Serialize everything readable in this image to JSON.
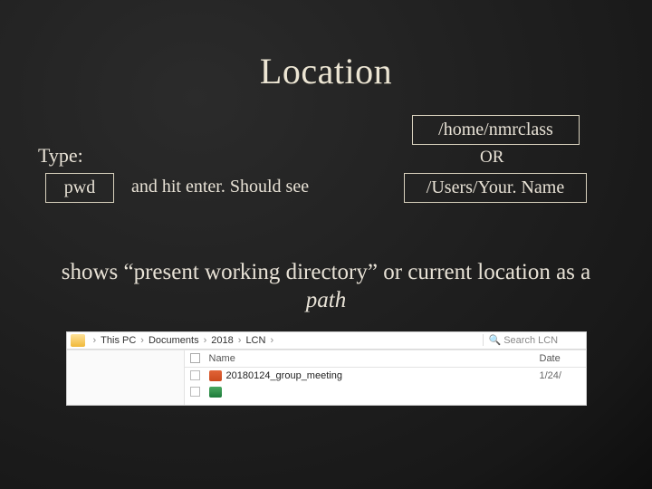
{
  "title": "Location",
  "type_label": "Type:",
  "pwd_box": "pwd",
  "instruction": "and hit enter. Should see",
  "path_home": "/home/nmrclass",
  "or_label": "OR",
  "path_users": "/Users/Your. Name",
  "desc_prefix": "shows “present working directory” or current location as a ",
  "desc_italic": "path",
  "explorer": {
    "crumbs": [
      "This PC",
      "Documents",
      "2018",
      "LCN"
    ],
    "search_placeholder": "Search LCN",
    "col_name": "Name",
    "col_date": "Date",
    "rows": [
      {
        "icon": "ppt",
        "name": "20180124_group_meeting",
        "date": "1/24/"
      },
      {
        "icon": "xls",
        "name": "",
        "date": ""
      }
    ]
  }
}
